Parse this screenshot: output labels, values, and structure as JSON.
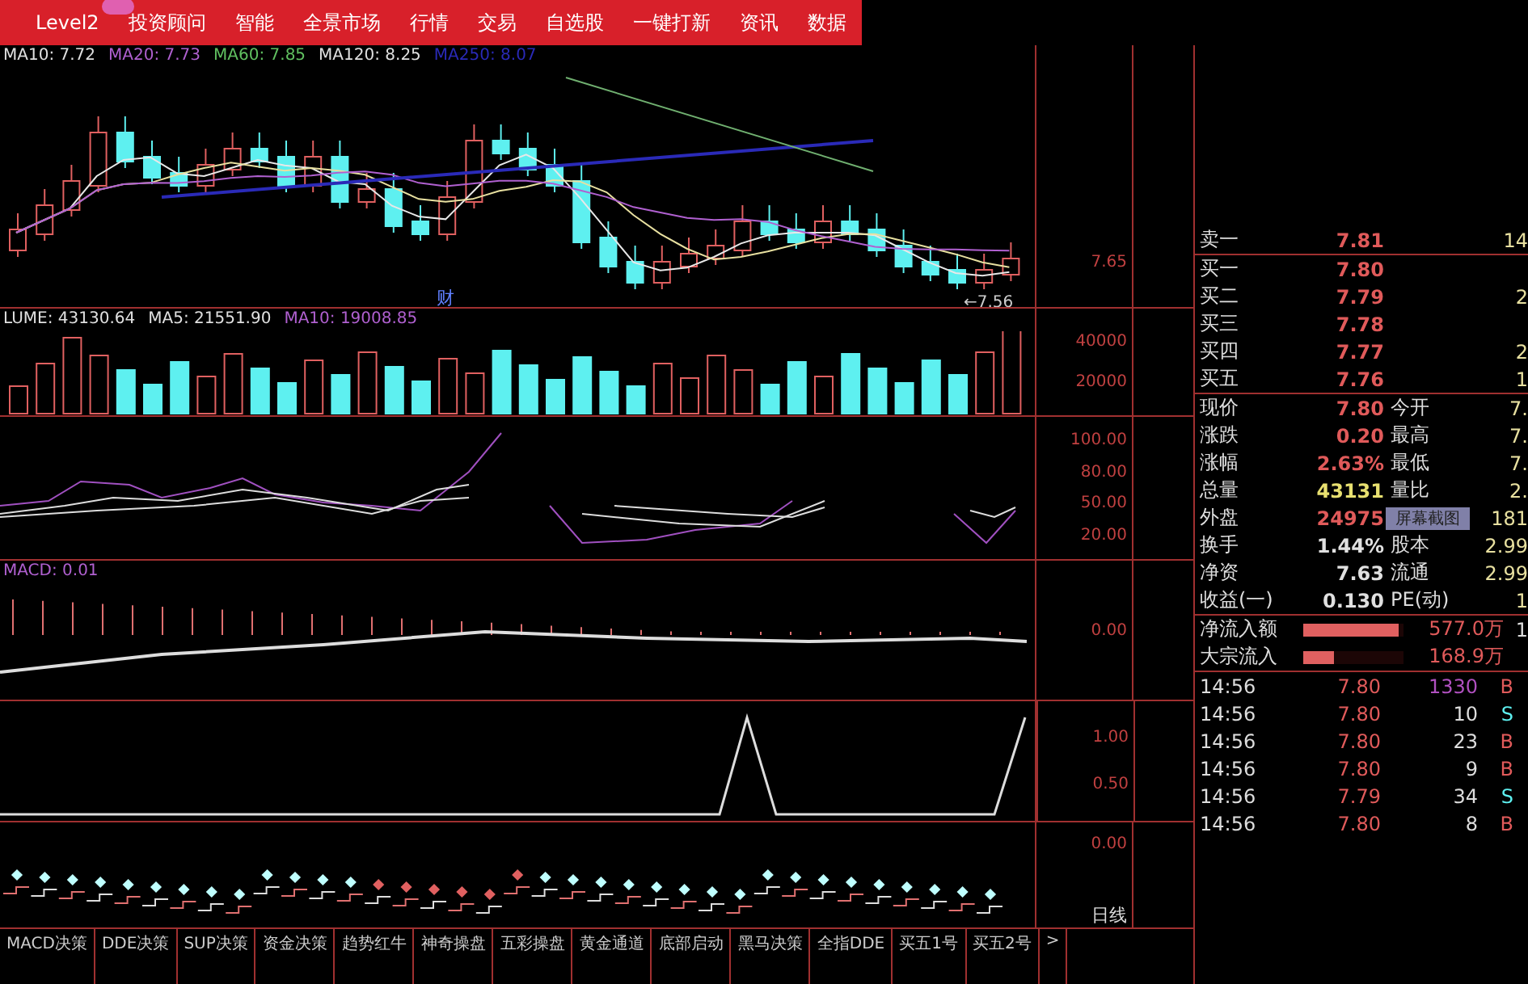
{
  "menu": {
    "items": [
      {
        "label": "Level2",
        "badge": true
      },
      {
        "label": "投资顾问",
        "badge": false
      },
      {
        "label": "智能",
        "badge": false
      },
      {
        "label": "全景市场",
        "badge": false
      },
      {
        "label": "行情",
        "badge": false
      },
      {
        "label": "交易",
        "badge": false
      },
      {
        "label": "自选股",
        "badge": false
      },
      {
        "label": "一键打新",
        "badge": false
      },
      {
        "label": "资讯",
        "badge": false
      },
      {
        "label": "数据",
        "badge": false
      }
    ]
  },
  "price_panel": {
    "legend": [
      {
        "text": "MA10: 7.72",
        "color": "#e0e0e0"
      },
      {
        "text": "MA20: 7.73",
        "color": "#b060d0"
      },
      {
        "text": "MA60: 7.85",
        "color": "#60c060"
      },
      {
        "text": "MA120: 8.25",
        "color": "#e0e0e0"
      },
      {
        "text": "MA250: 8.07",
        "color": "#2a2ab8"
      }
    ],
    "axis": [
      "7.65"
    ],
    "event_marker": "财",
    "low_marker": "←7.56"
  },
  "volume_panel": {
    "legend": [
      {
        "text": "LUME: 43130.64",
        "color": "#e0e0e0"
      },
      {
        "text": "MA5: 21551.90",
        "color": "#e0e0e0"
      },
      {
        "text": "MA10: 19008.85",
        "color": "#b060d0"
      }
    ],
    "axis": [
      "40000",
      "20000"
    ]
  },
  "kdj_panel": {
    "axis": [
      "100.00",
      "80.00",
      "50.00",
      "20.00"
    ]
  },
  "macd_panel": {
    "legend": [
      {
        "text": "MACD: 0.01",
        "color": "#b060d0"
      }
    ],
    "axis": [
      "0.00"
    ]
  },
  "signal_panel": {
    "axis": [
      "1.00",
      "0.50"
    ]
  },
  "dots_panel": {
    "axis": [
      "0.00"
    ],
    "period": "日线"
  },
  "bottom_tabs": [
    {
      "label": "MACD决策"
    },
    {
      "label": "DDE决策"
    },
    {
      "label": "SUP决策"
    },
    {
      "label": "资金决策"
    },
    {
      "label": "趋势红牛"
    },
    {
      "label": "神奇操盘"
    },
    {
      "label": "五彩操盘"
    },
    {
      "label": "黄金通道"
    },
    {
      "label": "底部启动"
    },
    {
      "label": "黑马决策"
    },
    {
      "label": "全指DDE"
    },
    {
      "label": "买五1号"
    },
    {
      "label": "买五2号"
    },
    {
      "label": ">"
    }
  ],
  "order_book": [
    {
      "label": "卖一",
      "price": "7.81",
      "volume": "14"
    },
    {
      "label": "买一",
      "price": "7.80"
    },
    {
      "label": "买二",
      "price": "7.79",
      "volume": "2"
    },
    {
      "label": "买三",
      "price": "7.78"
    },
    {
      "label": "买四",
      "price": "7.77",
      "volume": "2"
    },
    {
      "label": "买五",
      "price": "7.76",
      "volume": "1"
    }
  ],
  "stats": [
    {
      "label": "现价",
      "value": "7.80",
      "color": "#e05a5a",
      "label2": "今开",
      "value2": "7."
    },
    {
      "label": "涨跌",
      "value": "0.20",
      "color": "#e05a5a",
      "label2": "最高",
      "value2": "7."
    },
    {
      "label": "涨幅",
      "value": "2.63%",
      "color": "#e05a5a",
      "label2": "最低",
      "value2": "7."
    },
    {
      "label": "总量",
      "value": "43131",
      "color": "#e8e070",
      "label2": "量比",
      "value2": "2."
    },
    {
      "label": "外盘",
      "value": "24975",
      "color": "#e05a5a",
      "overlay": "屏幕截图",
      "value2": "181"
    },
    {
      "label": "换手",
      "value": "1.44%",
      "color": "#e0e0e0",
      "label2": "股本",
      "value2": "2.99"
    },
    {
      "label": "净资",
      "value": "7.63",
      "color": "#e0e0e0",
      "label2": "流通",
      "value2": "2.99"
    },
    {
      "label": "收益(一)",
      "value": "0.130",
      "color": "#e0e0e0",
      "label2": "PE(动)",
      "value2": "1"
    }
  ],
  "flows": [
    {
      "label": "净流入额",
      "level": 0.95,
      "value": "577.0万",
      "extra": "1"
    },
    {
      "label": "大宗流入",
      "level": 0.3,
      "value": "168.9万"
    }
  ],
  "ticks": [
    {
      "time": "14:56",
      "price": "7.80",
      "volume": "1330",
      "big": true,
      "side": "B"
    },
    {
      "time": "14:56",
      "price": "7.80",
      "volume": "10",
      "big": false,
      "side": "S"
    },
    {
      "time": "14:56",
      "price": "7.80",
      "volume": "23",
      "big": false,
      "side": "B"
    },
    {
      "time": "14:56",
      "price": "7.80",
      "volume": "9",
      "big": false,
      "side": "B"
    },
    {
      "time": "14:56",
      "price": "7.79",
      "volume": "34",
      "big": false,
      "side": "S"
    },
    {
      "time": "14:56",
      "price": "7.80",
      "volume": "8",
      "big": false,
      "side": "B"
    }
  ]
}
